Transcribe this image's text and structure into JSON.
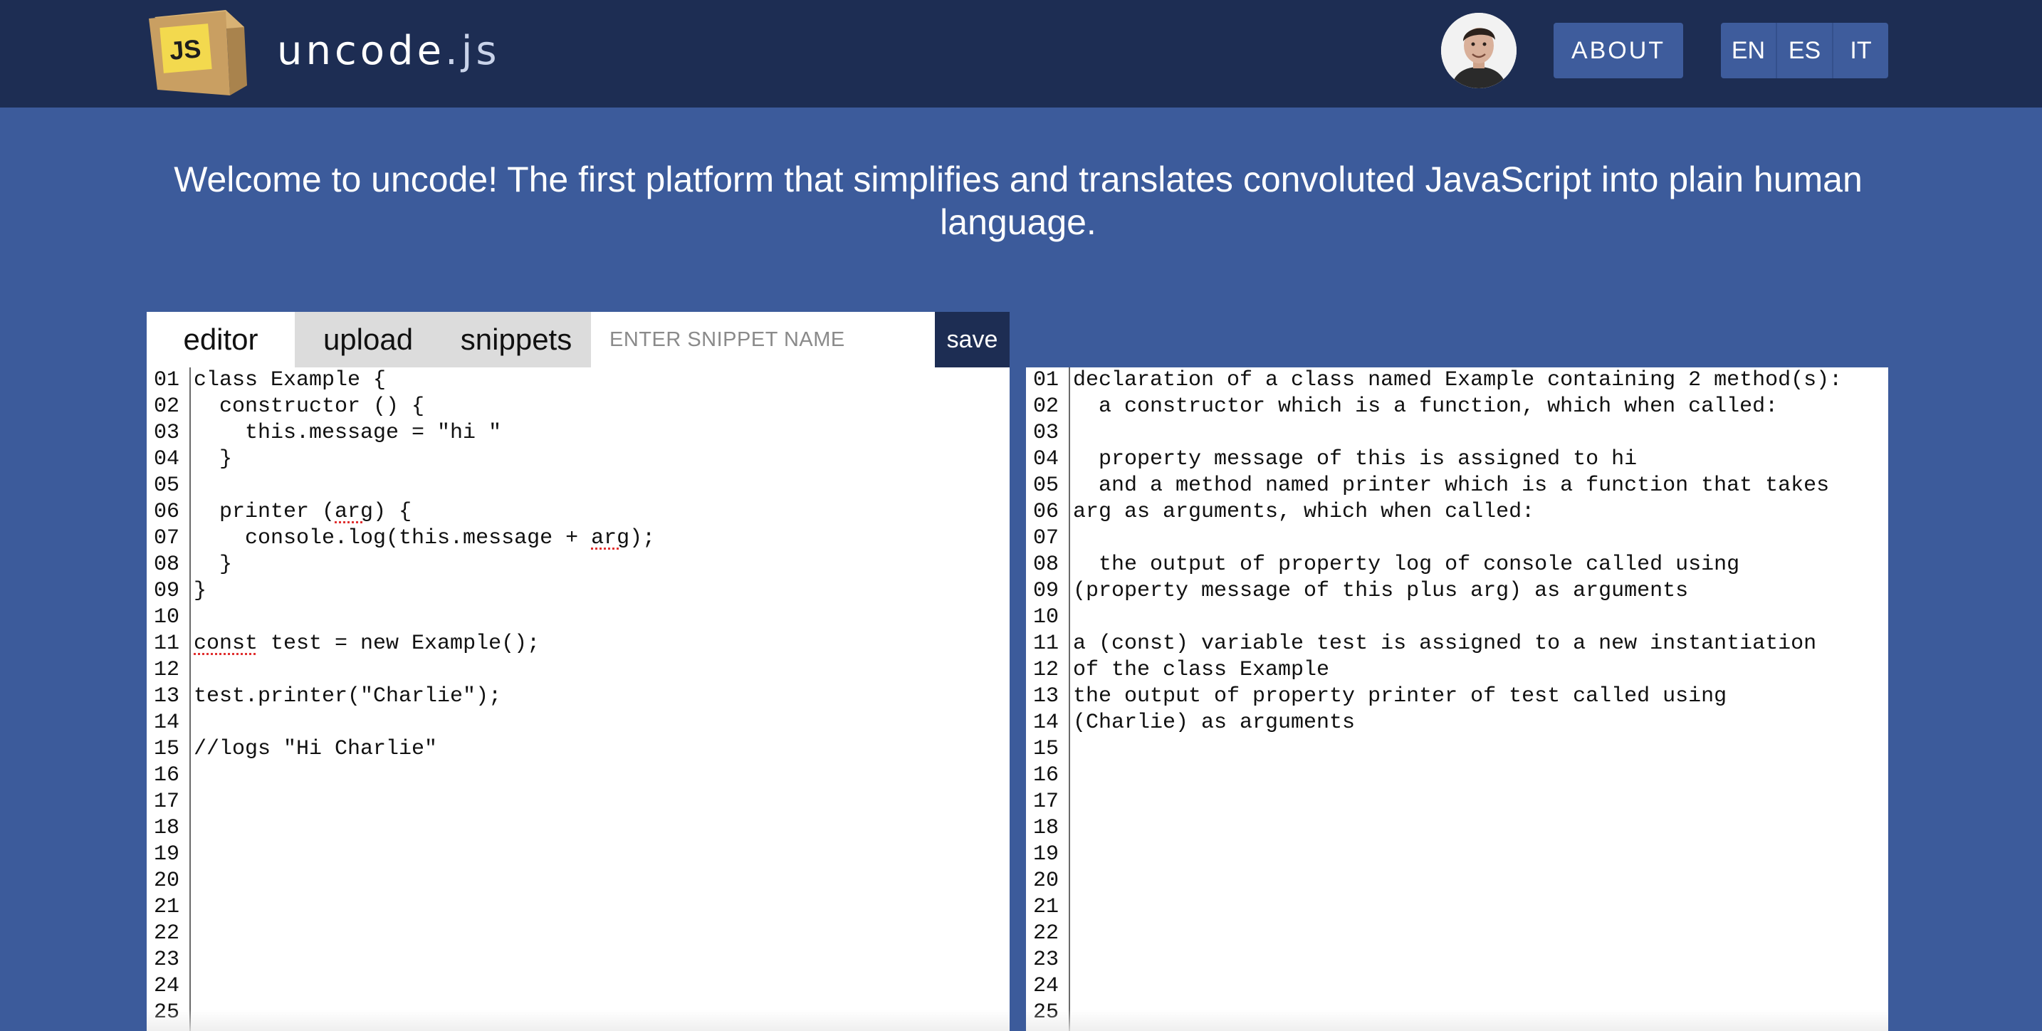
{
  "header": {
    "logo_badge": "JS",
    "logo_name": "uncode",
    "logo_ext": ".js",
    "about_label": "ABOUT",
    "languages": [
      "EN",
      "ES",
      "IT"
    ]
  },
  "welcome": {
    "line1": "Welcome to uncode! The first platform that simplifies and translates convoluted JavaScript into plain human",
    "line2": "language."
  },
  "editor": {
    "tabs": {
      "editor": "editor",
      "upload": "upload",
      "snippets": "snippets"
    },
    "snippet_placeholder": "ENTER SNIPPET NAME",
    "save_label": "save",
    "line_numbers": [
      "01",
      "02",
      "03",
      "04",
      "05",
      "06",
      "07",
      "08",
      "09",
      "10",
      "11",
      "12",
      "13",
      "14",
      "15",
      "16",
      "17",
      "18",
      "19",
      "20",
      "21",
      "22",
      "23",
      "24",
      "25"
    ],
    "code": {
      "l01": "class Example {",
      "l02": "  constructor () {",
      "l03": "    this.message = \"hi \"",
      "l04": "  }",
      "l05": "",
      "l06a": "  printer (",
      "l06b": "arg",
      "l06c": ") {",
      "l07a": "    console.log(this.message + ",
      "l07b": "arg",
      "l07c": ");",
      "l08": "  }",
      "l09": "}",
      "l10": "",
      "l11a": "const",
      "l11b": " test = new Example();",
      "l12": "",
      "l13": "test.printer(\"Charlie\");",
      "l14": "",
      "l15": "//logs \"Hi Charlie\""
    }
  },
  "output": {
    "line_numbers": [
      "01",
      "02",
      "03",
      "04",
      "05",
      "06",
      "07",
      "08",
      "09",
      "10",
      "11",
      "12",
      "13",
      "14",
      "15",
      "16",
      "17",
      "18",
      "19",
      "20",
      "21",
      "22",
      "23",
      "24",
      "25"
    ],
    "text": {
      "l01": "declaration of a class named Example containing 2 method(s):",
      "l02": "  a constructor which is a function, which when called:",
      "l03": "",
      "l04": "  property message of this is assigned to hi",
      "l05": "  and a method named printer which is a function that takes",
      "l06": "arg as arguments, which when called:",
      "l07": "",
      "l08": "  the output of property log of console called using",
      "l09": "(property message of this plus arg) as arguments",
      "l10": "",
      "l11": "a (const) variable test is assigned to a new instantiation",
      "l12": "of the class Example",
      "l13": "the output of property printer of test called using",
      "l14": "(Charlie) as arguments"
    }
  },
  "colors": {
    "page_bg": "#3c5b9b",
    "header_bg": "#1d2d53",
    "button_bg": "#3e5c9c",
    "logo_yellow": "#f3d94e",
    "squiggle_red": "#e03030"
  }
}
